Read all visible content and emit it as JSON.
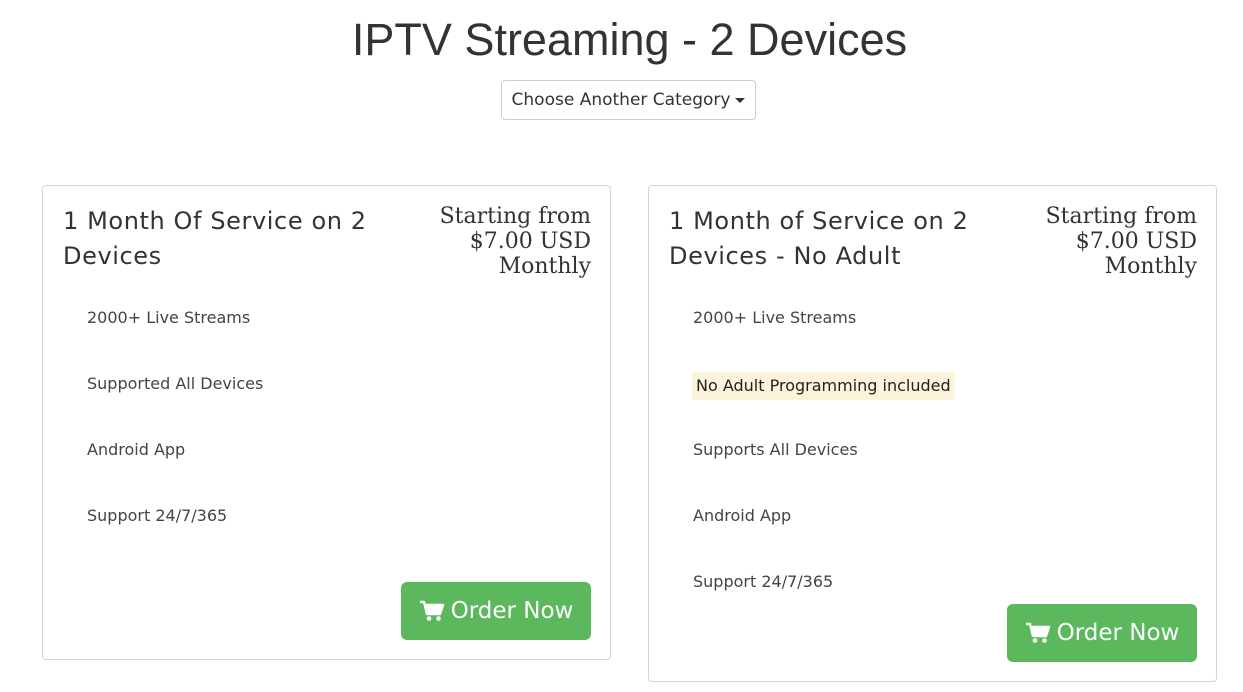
{
  "page": {
    "title": "IPTV Streaming - 2 Devices",
    "category_button": "Choose Another Category"
  },
  "products": [
    {
      "title": "1 Month Of Service on 2 Devices",
      "price_prefix": "Starting from",
      "price": "$7.00 USD",
      "billing": "Monthly",
      "features": [
        "2000+ Live Streams",
        "Supported All Devices",
        "Android App",
        "Support 24/7/365"
      ],
      "order_label": "Order Now"
    },
    {
      "title": "1 Month of Service on 2 Devices - No Adult",
      "price_prefix": "Starting from",
      "price": "$7.00 USD",
      "billing": "Monthly",
      "features": [
        "2000+ Live Streams",
        "No Adult Programming included",
        "Supports All Devices",
        "Android App",
        "Support 24/7/365"
      ],
      "order_label": "Order Now"
    }
  ],
  "colors": {
    "order_button": "#5cb85c",
    "highlight_background": "#fcf3dc"
  },
  "icons": {
    "dropdown": "caret-down-icon",
    "order": "shopping-cart-icon"
  }
}
